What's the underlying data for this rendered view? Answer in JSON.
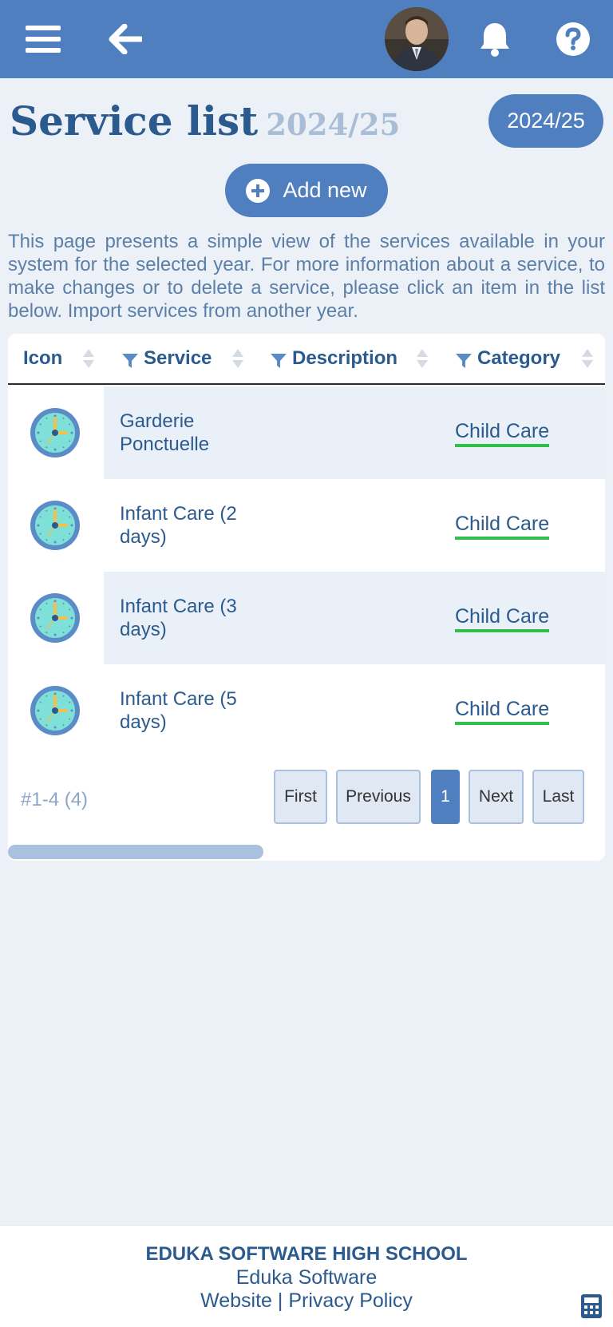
{
  "topbar": {
    "menu_icon": "hamburger-menu-icon",
    "back_icon": "arrow-left-icon",
    "avatar": "user-avatar",
    "notification_icon": "bell-icon",
    "help_icon": "question-circle-icon",
    "color": "#4f7fbe"
  },
  "page": {
    "title": "Service list",
    "title_year": "2024/25",
    "year_badge": "2024/25",
    "add_label": "Add new",
    "intro": "This page presents a simple view of the services available in your system for the selected year. For more information about a service, to make changes or to delete a service, please click an item in the list below. Import services from another year."
  },
  "table": {
    "columns": [
      "Icon",
      "Service",
      "Description",
      "Category"
    ],
    "rows": [
      {
        "icon": "clock-icon",
        "service": "Garderie Ponctuelle",
        "description": "",
        "category": "Child Care"
      },
      {
        "icon": "clock-icon",
        "service": "Infant Care (2 days)",
        "description": "",
        "category": "Child Care"
      },
      {
        "icon": "clock-icon",
        "service": "Infant Care (3 days)",
        "description": "",
        "category": "Child Care"
      },
      {
        "icon": "clock-icon",
        "service": "Infant Care (5 days)",
        "description": "",
        "category": "Child Care"
      }
    ],
    "count": "#1-4 (4)",
    "pagination": [
      "First",
      "Previous",
      "1",
      "Next",
      "Last"
    ],
    "active_page": "1",
    "category_underline_color": "#2fbf4a"
  },
  "footer": {
    "school": "EDUKA SOFTWARE HIGH SCHOOL",
    "company": "Eduka Software",
    "link_website": "Website",
    "separator": "|",
    "link_privacy": "Privacy Policy",
    "calculator_icon": "calculator-icon"
  }
}
